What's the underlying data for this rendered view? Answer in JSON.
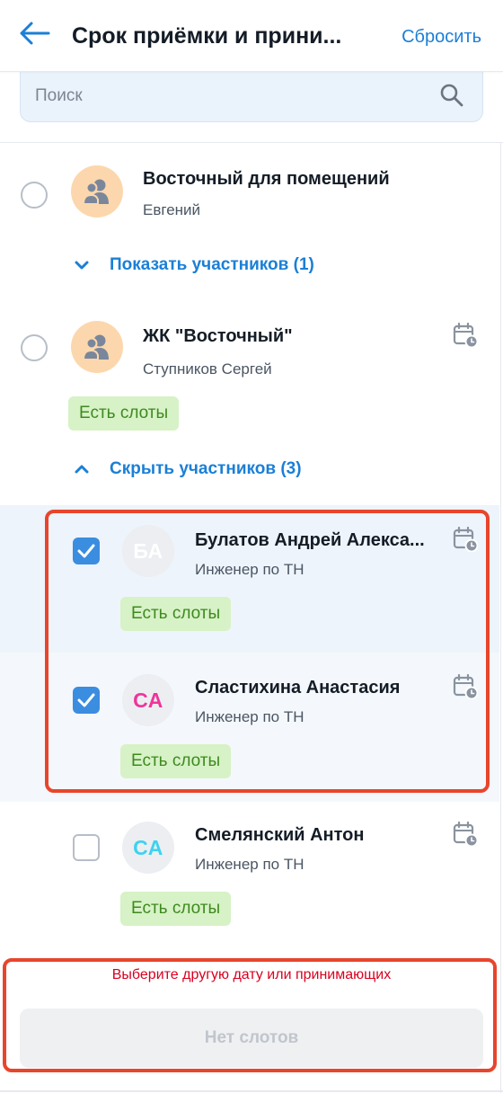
{
  "header": {
    "title": "Срок приёмки и прини...",
    "reset_label": "Сбросить"
  },
  "search": {
    "placeholder": "Поиск",
    "value": ""
  },
  "groups": [
    {
      "name": "Восточный для помещений",
      "subtitle": "Евгений",
      "toggle_label": "Показать участников (1)",
      "expanded": false
    },
    {
      "name": "ЖК \"Восточный\"",
      "subtitle": "Ступников Сергей",
      "badge": "Есть слоты",
      "toggle_label": "Скрыть участников (3)",
      "expanded": true
    }
  ],
  "members": [
    {
      "initials": "БА",
      "initials_color": "#ffffff",
      "name": "Булатов Андрей Алекса...",
      "role": "Инженер по ТН",
      "badge": "Есть слоты",
      "checked": true
    },
    {
      "initials": "СА",
      "initials_color": "#f0349a",
      "name": "Сластихина Анастасия",
      "role": "Инженер по ТН",
      "badge": "Есть слоты",
      "checked": true
    },
    {
      "initials": "СА",
      "initials_color": "#3cd3f0",
      "name": "Смелянский Антон",
      "role": "Инженер по ТН",
      "badge": "Есть слоты",
      "checked": false
    }
  ],
  "footer": {
    "error": "Выберите другую дату или принимающих",
    "button_label": "Нет слотов"
  },
  "colors": {
    "accent": "#1b7fd6",
    "badge_bg": "#d7f2c6",
    "badge_text": "#3e8a1f",
    "highlight": "#e8452c",
    "error": "#d8001f"
  },
  "icons": {
    "back": "arrow-left-icon",
    "search": "search-icon",
    "group": "group-avatar-icon",
    "calendar": "calendar-clock-icon",
    "check": "checkmark-icon"
  }
}
